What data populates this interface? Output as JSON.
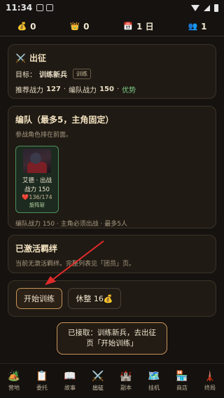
{
  "status": {
    "time": "11:34"
  },
  "resources": {
    "gold": "0",
    "crown": "0",
    "day": "1 日",
    "people": "1",
    "icons": {
      "gold": "money-bag-icon",
      "crown": "crown-icon",
      "day": "calendar-icon",
      "people": "people-icon"
    }
  },
  "expedition": {
    "title": "出征",
    "target_label": "目标：",
    "target_value": "训练新兵",
    "target_tag": "训练",
    "recommend_label": "推荐战力",
    "recommend_value": "127",
    "team_label": "编队战力",
    "team_value": "150",
    "verdict": "优势",
    "sep": "·"
  },
  "formation": {
    "title": "编队（最多5，主角固定）",
    "hint": "参战角色排在前面。",
    "hero": {
      "name": "艾德 · 出战",
      "power": "战力 150",
      "hp": "136/174",
      "role": "旋阵斩"
    },
    "footer": "编队战力 150 · 主角必须出战 · 最多5人"
  },
  "bonds": {
    "title": "已激活羁绊",
    "text": "当前无激活羁绊。完整列表见「团员」页。"
  },
  "actions": {
    "start_training": "开始训练",
    "rest": "休整 16💰"
  },
  "toast": {
    "text": "已接取：训练新兵，去出征页「开始训练」"
  },
  "nav": [
    {
      "label": "营地",
      "icon": "🏕️"
    },
    {
      "label": "委托",
      "icon": "📋"
    },
    {
      "label": "故事",
      "icon": "📖"
    },
    {
      "label": "出征",
      "icon": "⚔️"
    },
    {
      "label": "副本",
      "icon": "🏰"
    },
    {
      "label": "挂机",
      "icon": "🗺️"
    },
    {
      "label": "商店",
      "icon": "🏪"
    },
    {
      "label": "终局",
      "icon": "🗼"
    }
  ],
  "colors": {
    "accent": "#c7935a",
    "good": "#7fcf8a",
    "arrow": "#e12b2b"
  }
}
